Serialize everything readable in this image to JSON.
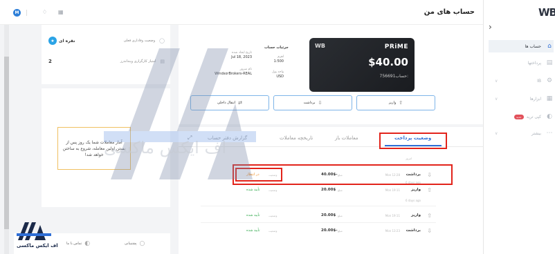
{
  "header": {
    "page_title": "حساب های من",
    "avatar_letter": "M"
  },
  "sidebar": {
    "logo": "WB",
    "items": [
      {
        "label": "حساب ها",
        "icon": "home-icon",
        "active": true
      },
      {
        "label": "پرداختها",
        "icon": "wallet-icon",
        "active": false
      },
      {
        "label": "IB",
        "icon": "network-icon",
        "active": false
      },
      {
        "label": "ابزارها",
        "icon": "grid-icon",
        "active": false
      },
      {
        "label": "کپی ترید",
        "icon": "copy-icon",
        "active": false,
        "badge": "جدید"
      },
      {
        "label": "بیشتر",
        "icon": "more-icon",
        "active": false
      }
    ]
  },
  "stats": {
    "loyalty_label": "وضعیت وفاداری فعلی",
    "loyalty_value": "نقره ای",
    "trader_label": "امتیاز کارگزاری وینداندرز",
    "trader_value": "2"
  },
  "callout": {
    "text": "آمار معاملات شما یک روز پس از بستن اولین معامله، شروع به ساختن خواهد شد!"
  },
  "footer": {
    "support_label": "پشتیبانی",
    "contact_label": "تماس با ما",
    "brand_name": "اف ایکس ماکسی"
  },
  "account_card": {
    "brand_mark": "WB",
    "type": "PRiME",
    "balance": "$40.00",
    "account_label": "حساب:",
    "account_number": "756691"
  },
  "details": {
    "title": "جزئیات حساب",
    "items": [
      {
        "label": "تاریخ ایجاد شده",
        "value": "Jul 18, 2023"
      },
      {
        "label": "اهرم",
        "value": "1:500"
      },
      {
        "label": "نام سرور",
        "value": "WindsorBrokers-REAL"
      },
      {
        "label": "واحد پول",
        "value": "USD"
      }
    ]
  },
  "actions": {
    "deposit": "واریز",
    "withdraw": "برداشت",
    "transfer": "انتقال داخلی"
  },
  "tabs": [
    {
      "label": "وضعیت پرداخت",
      "active": true
    },
    {
      "label": "معاملات باز",
      "active": false
    },
    {
      "label": "تاریخچه معاملات",
      "active": false
    },
    {
      "label": "گزارش دفتر حساب",
      "active": false
    }
  ],
  "transactions": {
    "groups": [
      {
        "date": "امروز",
        "rows": [
          {
            "type": "برداشت",
            "time": "Mon 12:28",
            "amount": "40.00$-",
            "amount_label": "مبلغ",
            "status": "در انتظار",
            "status_label": "وضعیت",
            "status_color": "#f08a1c"
          }
        ]
      },
      {
        "date": "6 days ago",
        "rows": [
          {
            "type": "واریز",
            "time": "Mon 19:11",
            "amount": "20.00$",
            "amount_label": "مبلغ",
            "status": "تأیید شده",
            "status_label": "وضعیت",
            "status_color": "#2ea84a"
          }
        ]
      },
      {
        "date": "6 days ago",
        "rows": [
          {
            "type": "واریز",
            "time": "Mon 19:11",
            "amount": "20.00$",
            "amount_label": "مبلغ",
            "status": "تأیید شده",
            "status_label": "وضعیت",
            "status_color": "#2ea84a"
          },
          {
            "type": "برداشت",
            "time": "Mon 13:23",
            "amount": "20.00$-",
            "amount_label": "مبلغ",
            "status": "تأیید شده",
            "status_label": "وضعیت",
            "status_color": "#2ea84a"
          }
        ]
      }
    ]
  },
  "watermark": {
    "text": "اف ایکس ماکسی"
  },
  "colors": {
    "accent": "#2e6ed6",
    "highlight": "#e2231a",
    "pending": "#f08a1c",
    "confirmed": "#2ea84a"
  }
}
